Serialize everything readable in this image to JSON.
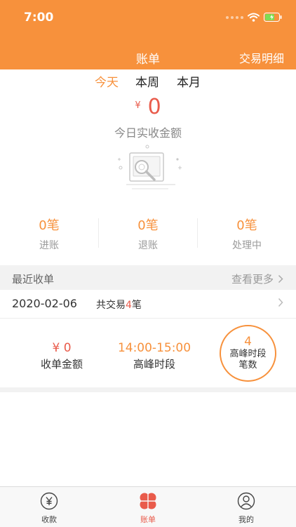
{
  "status": {
    "time": "7:00"
  },
  "nav": {
    "title": "账单",
    "right_link": "交易明细"
  },
  "period_tabs": [
    {
      "label": "今天",
      "active": true
    },
    {
      "label": "本周",
      "active": false
    },
    {
      "label": "本月",
      "active": false
    }
  ],
  "amount": {
    "currency": "¥",
    "value": "0",
    "label": "今日实收金额"
  },
  "stats": [
    {
      "value": "0笔",
      "label": "进账"
    },
    {
      "value": "0笔",
      "label": "退账"
    },
    {
      "value": "0笔",
      "label": "处理中"
    }
  ],
  "recent": {
    "title": "最近收单",
    "more_label": "查看更多"
  },
  "day": {
    "date": "2020-02-06",
    "prefix": "共交易",
    "count": "4",
    "suffix": "笔"
  },
  "summary": {
    "amount_value": "¥ 0",
    "amount_label": "收单金额",
    "peak_time_value": "14:00-15:00",
    "peak_time_label": "高峰时段",
    "peak_count_value": "4",
    "peak_count_label": "高峰时段笔数"
  },
  "tabbar": [
    {
      "label": "收款",
      "icon": "yen-circle-icon",
      "active": false
    },
    {
      "label": "账单",
      "icon": "clover-icon",
      "active": true
    },
    {
      "label": "我的",
      "icon": "user-icon",
      "active": false
    }
  ],
  "colors": {
    "brand": "#f7913c",
    "accent_red": "#e95b4b"
  }
}
